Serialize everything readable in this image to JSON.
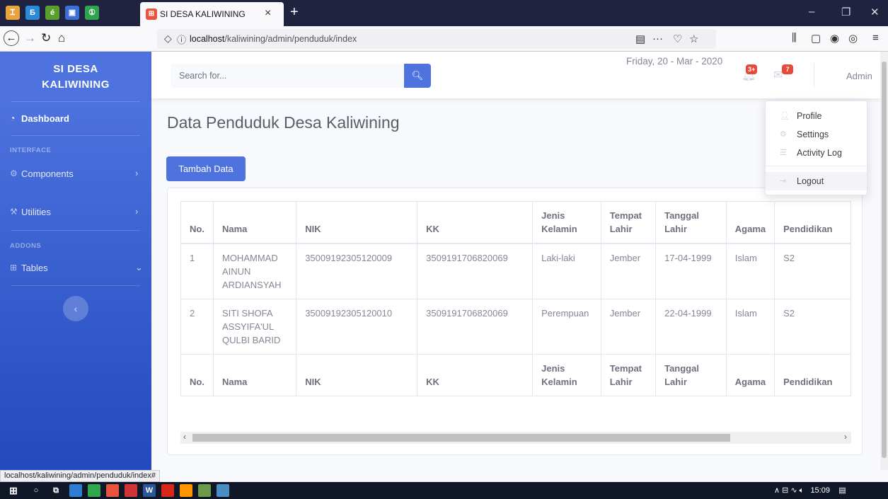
{
  "browser": {
    "tab_title": "SI DESA KALIWINING",
    "url_host": "localhost",
    "url_path": "/kaliwining/admin/penduduk/index",
    "status_url": "localhost/kaliwining/admin/penduduk/index#",
    "pinned_tabs": [
      "Ꮖ",
      "Б",
      "é",
      "▣",
      "①"
    ],
    "pinned_colors": [
      "#e8a33c",
      "#2b8ad6",
      "#5a9e2e",
      "#3c6ed8",
      "#2ea44f"
    ],
    "fav_glyph": "⊞"
  },
  "sidebar": {
    "brand_line1": "SI DESA",
    "brand_line2": "KALIWINING",
    "items": [
      {
        "label": "Dashboard",
        "icon": "tachometer-icon",
        "glyph": "◔"
      },
      {
        "label": "Components",
        "icon": "cog-icon",
        "glyph": "⚙",
        "chevron": "›"
      },
      {
        "label": "Utilities",
        "icon": "wrench-icon",
        "glyph": "⚒",
        "chevron": "›"
      },
      {
        "label": "Tables",
        "icon": "table-icon",
        "glyph": "⊞",
        "chevron": "⌄"
      }
    ],
    "heading_interface": "INTERFACE",
    "heading_addons": "ADDONS",
    "toggle_glyph": "‹"
  },
  "topbar": {
    "search_placeholder": "Search for...",
    "search_glyph": "🔍︎",
    "date": "Friday, 20 - Mar - 2020",
    "alerts_badge": "3+",
    "messages_badge": "7",
    "user_name": "Admin"
  },
  "dropdown": {
    "items": [
      "Profile",
      "Settings",
      "Activity Log"
    ],
    "logout": "Logout"
  },
  "main": {
    "title": "Data Penduduk Desa Kaliwining",
    "add_button": "Tambah Data",
    "columns": [
      "No.",
      "Nama",
      "NIK",
      "KK",
      "Jenis Kelamin",
      "Tempat Lahir",
      "Tanggal Lahir",
      "Agama",
      "Pendidikan"
    ],
    "rows": [
      [
        "1",
        "MOHAMMAD AINUN ARDIANSYAH",
        "35009192305120009",
        "3509191706820069",
        "Laki-laki",
        "Jember",
        "17-04-1999",
        "Islam",
        "S2"
      ],
      [
        "2",
        "SITI SHOFA ASSYIFA'UL QULBI BARID",
        "35009192305120010",
        "3509191706820069",
        "Perempuan",
        "Jember",
        "22-04-1999",
        "Islam",
        "S2"
      ]
    ]
  },
  "taskbar": {
    "time": "15:09",
    "tray": "∧  ⊟  ∿  🔈︎"
  }
}
